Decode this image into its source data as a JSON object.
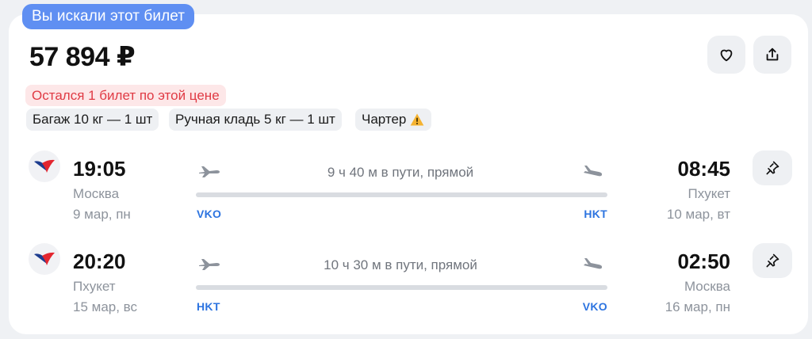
{
  "badge": {
    "label": "Вы искали этот билет"
  },
  "price": "57 894 ₽",
  "actions": {
    "favorite_icon": "heart-icon",
    "share_icon": "share-icon"
  },
  "warning": "Остался 1 билет по этой цене",
  "chips": {
    "baggage": "Багаж 10 кг — 1 шт",
    "hand_luggage": "Ручная кладь 5 кг — 1 шт",
    "charter": "Чартер",
    "charter_icon": "warning-icon"
  },
  "colors": {
    "accent": "#5f8ff2",
    "warning_text": "#e03a44",
    "warning_bg": "#fde7e8",
    "airport_code": "#2d74e0",
    "airline_red": "#e3262f",
    "airline_blue": "#1d3d8f"
  },
  "legs": [
    {
      "airline_icon": "airline-logo-icon",
      "dep_time": "19:05",
      "dep_city": "Москва",
      "dep_date": "9 мар, пн",
      "dep_code": "VKO",
      "duration": "9 ч 40 м в пути, прямой",
      "arr_time": "08:45",
      "arr_city": "Пхукет",
      "arr_date": "10 мар, вт",
      "arr_code": "HKT",
      "pin_icon": "pin-icon"
    },
    {
      "airline_icon": "airline-logo-icon",
      "dep_time": "20:20",
      "dep_city": "Пхукет",
      "dep_date": "15 мар, вс",
      "dep_code": "HKT",
      "duration": "10 ч 30 м в пути, прямой",
      "arr_time": "02:50",
      "arr_city": "Москва",
      "arr_date": "16 мар, пн",
      "arr_code": "VKO",
      "pin_icon": "pin-icon"
    }
  ]
}
